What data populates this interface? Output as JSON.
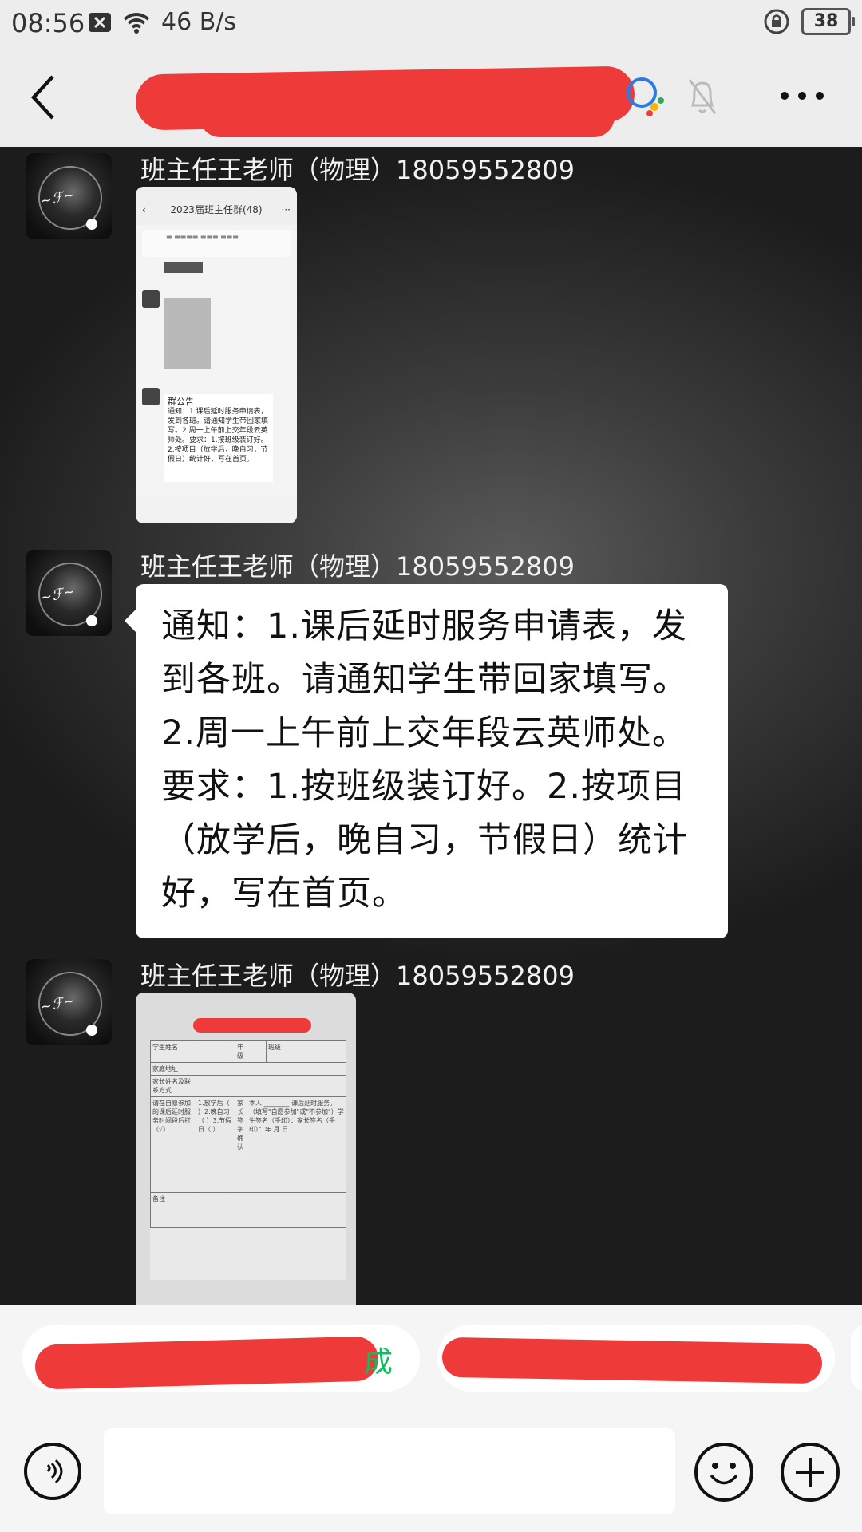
{
  "status_bar": {
    "time": "08:56",
    "net_speed": "46 B/s",
    "battery": "38"
  },
  "chat": {
    "messages": [
      {
        "sender": "班主任王老师（物理）18059552809",
        "type": "image",
        "image_desc": {
          "title": "2023届班主任群(48)",
          "card_title": "群公告",
          "card_text": "通知：1.课后延时服务申请表，发到各班。请通知学生带回家填写。2.周一上午前上交年段云英师处。要求：1.按班级装订好。2.按项目（放学后，晚自习，节假日）统计好，写在首页。"
        }
      },
      {
        "sender": "班主任王老师（物理）18059552809",
        "type": "text",
        "text": "通知：1.课后延时服务申请表，发到各班。请通知学生带回家填写。2.周一上午前上交年段云英师处。要求：1.按班级装订好。2.按项目（放学后，晚自习，节假日）统计好，写在首页。"
      },
      {
        "sender": "班主任王老师（物理）18059552809",
        "type": "image",
        "form": {
          "r1c1": "学生姓名",
          "r1c2": "年级",
          "r1c3": "班级",
          "r2c1": "家庭地址",
          "r3c1": "家长姓名及联系方式",
          "r4c1": "请在自愿参加的课后延时服务时间段后打（√）",
          "r4c2": "1.放学后（ ）2.晚自习（ ）3.节假日（ ）",
          "r4c3": "家长签字确认",
          "r4c4": "本人 ________ 课后延时服务。（填写\"自愿参加\"或\"不参加\"）学生签名（手印）：家长签名（手印）：年 月 日",
          "r5c1": "备注"
        }
      }
    ]
  },
  "quick_replies": {
    "first_suffix": "成"
  }
}
